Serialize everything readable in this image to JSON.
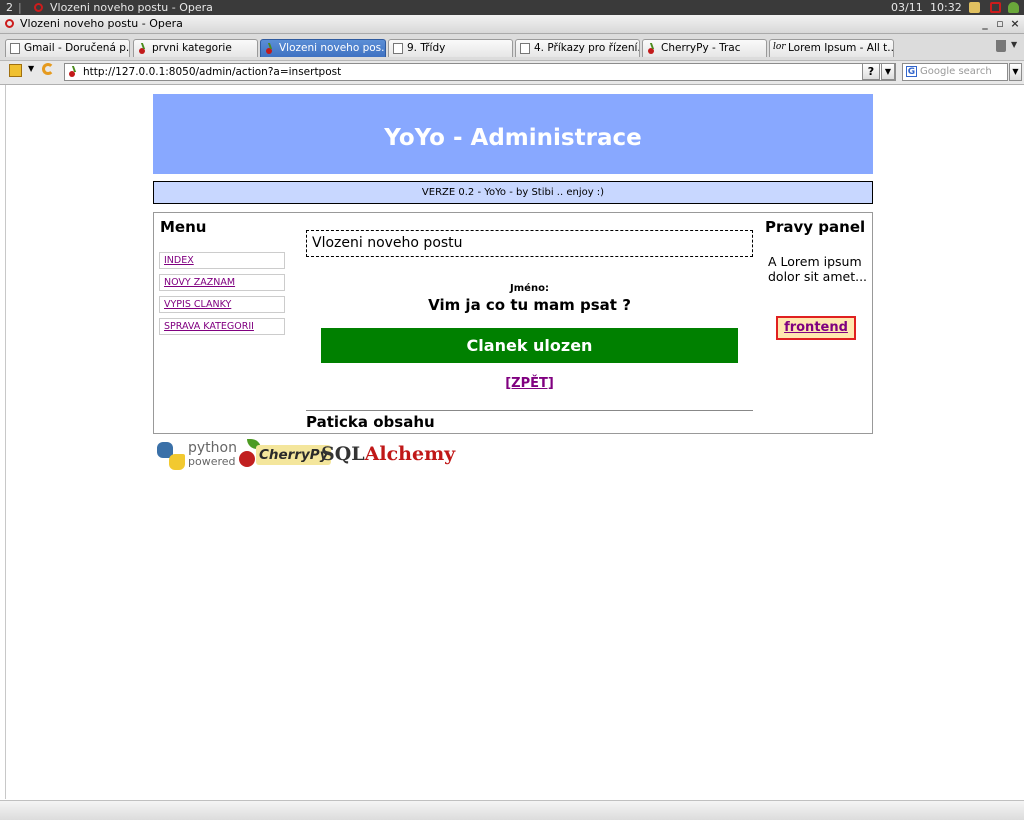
{
  "system_bar": {
    "workspace": "2",
    "separator": "|",
    "window_title": "Vlozeni noveho postu - Opera",
    "date": "03/11",
    "time": "10:32"
  },
  "window": {
    "title": "Vlozeni noveho postu - Opera",
    "controls": [
      "_",
      "▫",
      "×"
    ]
  },
  "tabs": [
    {
      "label": "Gmail - Doručená p...",
      "icon": "page-icon",
      "active": false
    },
    {
      "label": "prvni kategorie",
      "icon": "cherry-icon",
      "active": false
    },
    {
      "label": "Vlozeni noveho pos...",
      "icon": "cherry-icon",
      "active": true
    },
    {
      "label": "9. Třídy",
      "icon": "page-icon",
      "active": false
    },
    {
      "label": "4. Příkazy pro řízení...",
      "icon": "page-icon",
      "active": false
    },
    {
      "label": "CherryPy - Trac",
      "icon": "cherry-icon",
      "active": false
    },
    {
      "label": "Lorem Ipsum - All t...",
      "icon": "lorem-icon",
      "active": false
    }
  ],
  "address_bar": {
    "url": "http://127.0.0.1:8050/admin/action?a=insertpost",
    "help_label": "?",
    "search_placeholder": "Google search",
    "lorem_icon_text": "lor",
    "google_icon_text": "G"
  },
  "page": {
    "header_title": "YoYo - Administrace",
    "version_text": "VERZE 0.2 - YoYo - by Stibi .. enjoy :)",
    "menu": {
      "title": "Menu",
      "items": [
        "INDEX",
        "NOVY ZAZNAM",
        "VYPIS CLANKY",
        "SPRAVA KATEGORII"
      ]
    },
    "main": {
      "post_heading": "Vlozeni noveho postu",
      "name_label": "Jméno:",
      "name_value": "Vim ja co tu mam psat ?",
      "saved_message": "Clanek ulozen",
      "back_link": "[ZPĚT]",
      "footer_title": "Paticka obsahu"
    },
    "right_panel": {
      "title": "Pravy panel",
      "text": "A Lorem ipsum dolor sit amet...",
      "frontend_label": "frontend"
    },
    "logos": {
      "python_line1": "python",
      "python_line2": "powered",
      "cherrypy": "CherryPy",
      "sql": "SQL",
      "alchemy": "Alchemy"
    }
  },
  "colors": {
    "header_bg": "#88a8ff",
    "version_bg": "#c8d7ff",
    "saved_bg": "#008000",
    "link_visited": "#800080",
    "active_tab": "#3f72c2"
  }
}
